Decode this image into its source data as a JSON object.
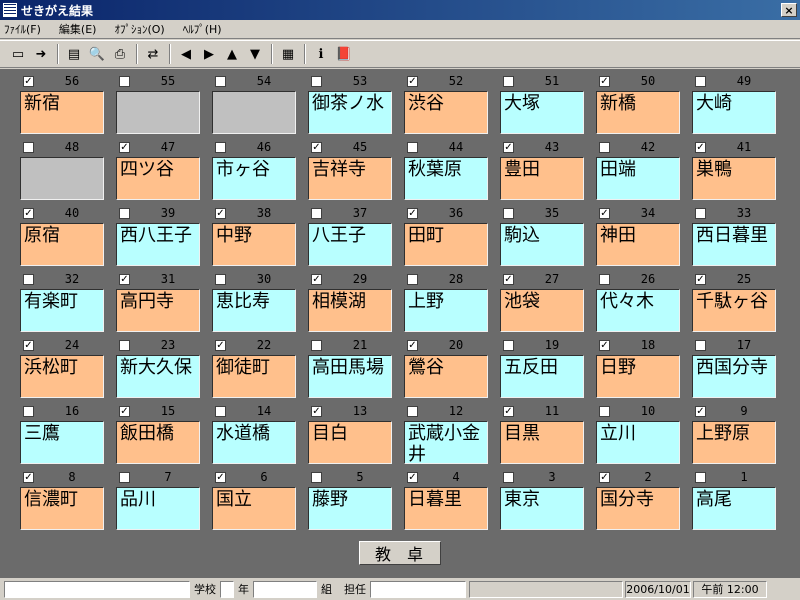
{
  "window": {
    "title": "せきがえ結果",
    "close_label": "×"
  },
  "menu": [
    {
      "id": "file",
      "label": "ﾌｧｲﾙ(F)"
    },
    {
      "id": "edit",
      "label": "編集(E)"
    },
    {
      "id": "options",
      "label": "ｵﾌﾟｼｮﾝ(O)"
    },
    {
      "id": "help",
      "label": "ﾍﾙﾌﾟ(H)"
    }
  ],
  "toolbar": {
    "buttons": [
      {
        "name": "save-icon",
        "glyph": "▭"
      },
      {
        "name": "export-icon",
        "glyph": "➜"
      },
      {
        "sep": true
      },
      {
        "name": "properties-icon",
        "glyph": "▤"
      },
      {
        "name": "print-preview-icon",
        "glyph": "🔍"
      },
      {
        "name": "print-icon",
        "glyph": "⎙"
      },
      {
        "sep": true
      },
      {
        "name": "shuffle-icon",
        "glyph": "⇄"
      },
      {
        "sep": true
      },
      {
        "name": "arrow-left-icon",
        "glyph": "◀"
      },
      {
        "name": "arrow-right-icon",
        "glyph": "▶"
      },
      {
        "name": "arrow-up-icon",
        "glyph": "▲"
      },
      {
        "name": "arrow-down-icon",
        "glyph": "▼"
      },
      {
        "sep": true
      },
      {
        "name": "settings-icon",
        "glyph": "▦"
      },
      {
        "sep": true
      },
      {
        "name": "info-icon",
        "glyph": "ℹ"
      },
      {
        "name": "book-icon",
        "glyph": "📕"
      }
    ]
  },
  "colors": {
    "orange": "#ffc08c",
    "cyan": "#b8ffff",
    "gray": "#c0c0c0",
    "background": "#6b6b6b"
  },
  "seats": [
    [
      {
        "num": "56",
        "checked": true,
        "name": "新宿",
        "color": "orange"
      },
      {
        "num": "55",
        "checked": false,
        "name": "",
        "color": "gray"
      },
      {
        "num": "54",
        "checked": false,
        "name": "",
        "color": "gray"
      },
      {
        "num": "53",
        "checked": false,
        "name": "御茶ノ水",
        "color": "cyan"
      },
      {
        "num": "52",
        "checked": true,
        "name": "渋谷",
        "color": "orange"
      },
      {
        "num": "51",
        "checked": false,
        "name": "大塚",
        "color": "cyan"
      },
      {
        "num": "50",
        "checked": true,
        "name": "新橋",
        "color": "orange"
      },
      {
        "num": "49",
        "checked": false,
        "name": "大崎",
        "color": "cyan"
      }
    ],
    [
      {
        "num": "48",
        "checked": false,
        "name": "",
        "color": "gray"
      },
      {
        "num": "47",
        "checked": true,
        "name": "四ツ谷",
        "color": "orange"
      },
      {
        "num": "46",
        "checked": false,
        "name": "市ヶ谷",
        "color": "cyan"
      },
      {
        "num": "45",
        "checked": true,
        "name": "吉祥寺",
        "color": "orange"
      },
      {
        "num": "44",
        "checked": false,
        "name": "秋葉原",
        "color": "cyan"
      },
      {
        "num": "43",
        "checked": true,
        "name": "豊田",
        "color": "orange"
      },
      {
        "num": "42",
        "checked": false,
        "name": "田端",
        "color": "cyan"
      },
      {
        "num": "41",
        "checked": true,
        "name": "巣鴨",
        "color": "orange"
      }
    ],
    [
      {
        "num": "40",
        "checked": true,
        "name": "原宿",
        "color": "orange"
      },
      {
        "num": "39",
        "checked": false,
        "name": "西八王子",
        "color": "cyan"
      },
      {
        "num": "38",
        "checked": true,
        "name": "中野",
        "color": "orange"
      },
      {
        "num": "37",
        "checked": false,
        "name": "八王子",
        "color": "cyan"
      },
      {
        "num": "36",
        "checked": true,
        "name": "田町",
        "color": "orange"
      },
      {
        "num": "35",
        "checked": false,
        "name": "駒込",
        "color": "cyan"
      },
      {
        "num": "34",
        "checked": true,
        "name": "神田",
        "color": "orange"
      },
      {
        "num": "33",
        "checked": false,
        "name": "西日暮里",
        "color": "cyan"
      }
    ],
    [
      {
        "num": "32",
        "checked": false,
        "name": "有楽町",
        "color": "cyan"
      },
      {
        "num": "31",
        "checked": true,
        "name": "高円寺",
        "color": "orange"
      },
      {
        "num": "30",
        "checked": false,
        "name": "恵比寿",
        "color": "cyan"
      },
      {
        "num": "29",
        "checked": true,
        "name": "相模湖",
        "color": "orange"
      },
      {
        "num": "28",
        "checked": false,
        "name": "上野",
        "color": "cyan"
      },
      {
        "num": "27",
        "checked": true,
        "name": "池袋",
        "color": "orange"
      },
      {
        "num": "26",
        "checked": false,
        "name": "代々木",
        "color": "cyan"
      },
      {
        "num": "25",
        "checked": true,
        "name": "千駄ヶ谷",
        "color": "orange"
      }
    ],
    [
      {
        "num": "24",
        "checked": true,
        "name": "浜松町",
        "color": "orange"
      },
      {
        "num": "23",
        "checked": false,
        "name": "新大久保",
        "color": "cyan"
      },
      {
        "num": "22",
        "checked": true,
        "name": "御徒町",
        "color": "orange"
      },
      {
        "num": "21",
        "checked": false,
        "name": "高田馬場",
        "color": "cyan"
      },
      {
        "num": "20",
        "checked": true,
        "name": "鶯谷",
        "color": "orange"
      },
      {
        "num": "19",
        "checked": false,
        "name": "五反田",
        "color": "cyan"
      },
      {
        "num": "18",
        "checked": true,
        "name": "日野",
        "color": "orange"
      },
      {
        "num": "17",
        "checked": false,
        "name": "西国分寺",
        "color": "cyan"
      }
    ],
    [
      {
        "num": "16",
        "checked": false,
        "name": "三鷹",
        "color": "cyan"
      },
      {
        "num": "15",
        "checked": true,
        "name": "飯田橋",
        "color": "orange"
      },
      {
        "num": "14",
        "checked": false,
        "name": "水道橋",
        "color": "cyan"
      },
      {
        "num": "13",
        "checked": true,
        "name": "目白",
        "color": "orange"
      },
      {
        "num": "12",
        "checked": false,
        "name": "武蔵小金井",
        "color": "cyan"
      },
      {
        "num": "11",
        "checked": true,
        "name": "目黒",
        "color": "orange"
      },
      {
        "num": "10",
        "checked": false,
        "name": "立川",
        "color": "cyan"
      },
      {
        "num": "9",
        "checked": true,
        "name": "上野原",
        "color": "orange"
      }
    ],
    [
      {
        "num": "8",
        "checked": true,
        "name": "信濃町",
        "color": "orange"
      },
      {
        "num": "7",
        "checked": false,
        "name": "品川",
        "color": "cyan"
      },
      {
        "num": "6",
        "checked": true,
        "name": "国立",
        "color": "orange"
      },
      {
        "num": "5",
        "checked": false,
        "name": "藤野",
        "color": "cyan"
      },
      {
        "num": "4",
        "checked": true,
        "name": "日暮里",
        "color": "orange"
      },
      {
        "num": "3",
        "checked": false,
        "name": "東京",
        "color": "cyan"
      },
      {
        "num": "2",
        "checked": true,
        "name": "国分寺",
        "color": "orange"
      },
      {
        "num": "1",
        "checked": false,
        "name": "高尾",
        "color": "cyan"
      }
    ]
  ],
  "desk_label": "教卓",
  "statusbar": {
    "school_label": "学校",
    "year_label": "年",
    "class_label": "組",
    "teacher_label": "担任",
    "date": "2006/10/01",
    "time": "午前 12:00"
  }
}
